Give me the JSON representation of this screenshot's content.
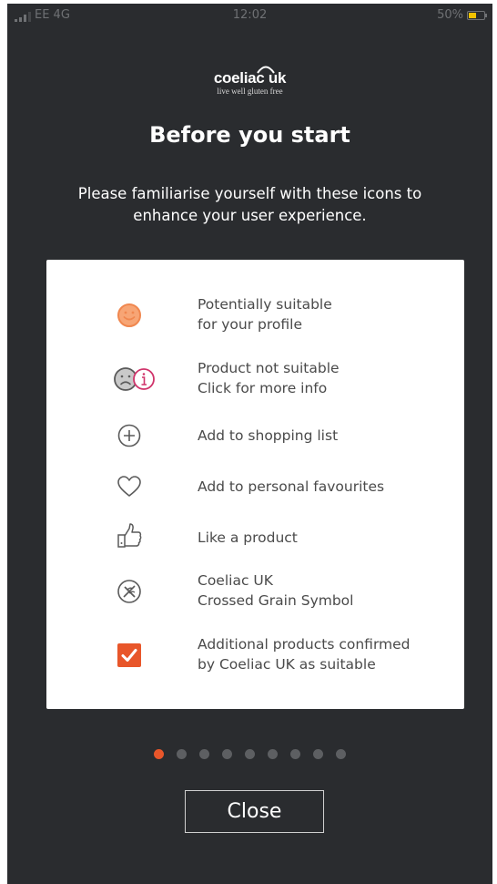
{
  "status_bar": {
    "carrier": "EE 4G",
    "time": "12:02",
    "battery": "50%",
    "battery_level": 0.5
  },
  "logo": {
    "name": "coeliac uk",
    "tagline": "live well gluten free"
  },
  "title": "Before you start",
  "subtitle": "Please familiarise yourself with these icons to enhance your user experience.",
  "legend": [
    {
      "icon": "smiley-face-icon",
      "line1": "Potentially suitable",
      "line2": "for your profile"
    },
    {
      "icon": "sad-face-info-icon",
      "line1": "Product not suitable",
      "line2": "Click for more info"
    },
    {
      "icon": "plus-circle-icon",
      "line1": "Add to shopping list",
      "line2": ""
    },
    {
      "icon": "heart-icon",
      "line1": "Add to personal favourites",
      "line2": ""
    },
    {
      "icon": "thumbs-up-icon",
      "line1": "Like a product",
      "line2": ""
    },
    {
      "icon": "crossed-grain-icon",
      "line1": "Coeliac UK",
      "line2": "Crossed Grain Symbol"
    },
    {
      "icon": "checkbox-checked-icon",
      "line1": "Additional products confirmed",
      "line2": "by Coeliac UK as suitable"
    }
  ],
  "pagination": {
    "total": 9,
    "active": 1
  },
  "close_button": {
    "label": "Close"
  },
  "colors": {
    "background": "#2a2c2f",
    "accent": "#e8562a",
    "smiley": "#f0874f",
    "info": "#d0336a",
    "icon_gray": "#5a5a5a"
  }
}
